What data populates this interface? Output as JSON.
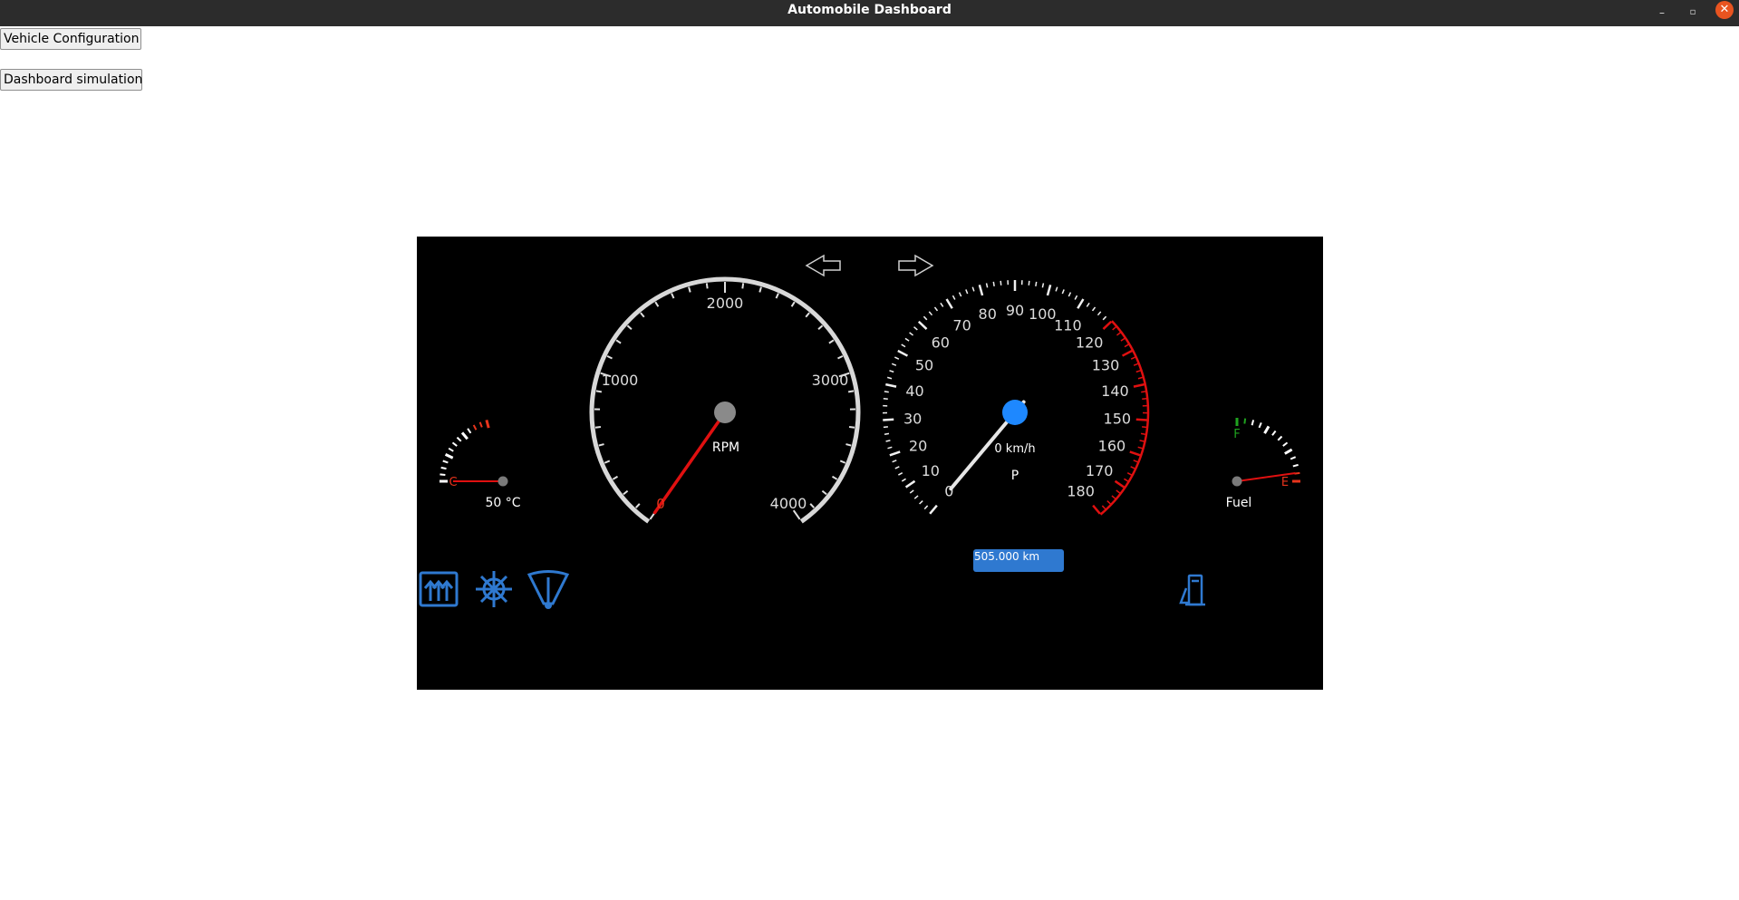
{
  "window": {
    "title": "Automobile Dashboard",
    "minimize_glyph": "–",
    "maximize_glyph": "▫",
    "close_glyph": "✕"
  },
  "buttons": {
    "vehicle_config": "Vehicle Configuration",
    "dashboard_sim": "Dashboard simulation"
  },
  "colors": {
    "accent_blue": "#2f79d0",
    "needle_red": "#e01010",
    "warning_red": "#e8341c",
    "fuel_green": "#1fa31f"
  },
  "temperature": {
    "low_label": "C",
    "value_label": "50 °C",
    "value": 50
  },
  "rpm": {
    "label": "RPM",
    "ticks": [
      "0",
      "1000",
      "2000",
      "3000",
      "4000"
    ],
    "value": 0
  },
  "speed": {
    "readout": "0 km/h",
    "gear": "P",
    "value": 0,
    "ticks": [
      "0",
      "10",
      "20",
      "30",
      "40",
      "50",
      "60",
      "70",
      "80",
      "90",
      "100",
      "110",
      "120",
      "130",
      "140",
      "150",
      "160",
      "170",
      "180"
    ],
    "redline_start": 120
  },
  "fuel": {
    "label": "Fuel",
    "full_label": "F",
    "empty_label": "E",
    "level": 0
  },
  "odometer": {
    "text": "505.000 km"
  },
  "indicators": {
    "left_turn": "left-turn-arrow-icon",
    "right_turn": "right-turn-arrow-icon",
    "rear_defrost": "rear-defrost-icon",
    "air_conditioning": "snowflake-icon",
    "wiper": "windshield-wiper-icon",
    "fuel_pump": "fuel-pump-icon"
  }
}
